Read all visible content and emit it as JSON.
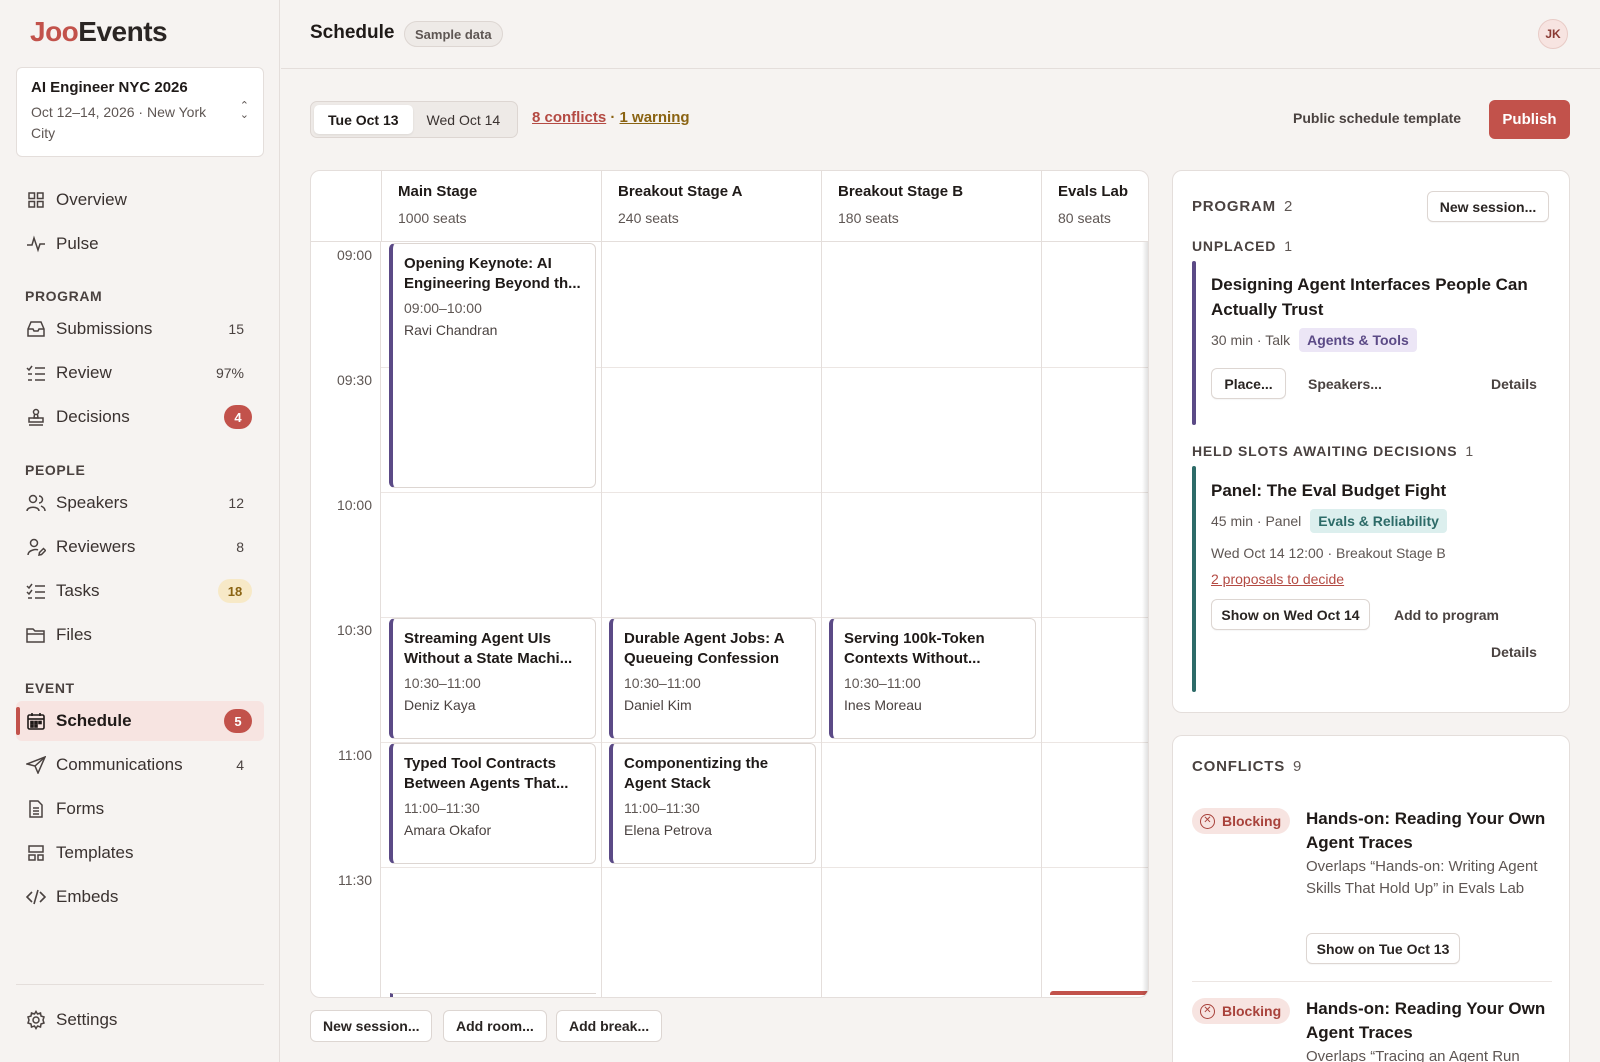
{
  "brand": {
    "logo_part1": "Joo",
    "logo_part2": "Events"
  },
  "event": {
    "name": "AI Engineer NYC 2026",
    "meta": "Oct 12–14, 2026 · New York City"
  },
  "nav": {
    "overview": "Overview",
    "pulse": "Pulse",
    "program_head": "PROGRAM",
    "submissions": {
      "label": "Submissions",
      "count": "15"
    },
    "review": {
      "label": "Review",
      "count": "97%"
    },
    "decisions": {
      "label": "Decisions",
      "count": "4"
    },
    "people_head": "PEOPLE",
    "speakers": {
      "label": "Speakers",
      "count": "12"
    },
    "reviewers": {
      "label": "Reviewers",
      "count": "8"
    },
    "tasks": {
      "label": "Tasks",
      "count": "18"
    },
    "files": {
      "label": "Files"
    },
    "event_head": "EVENT",
    "schedule": {
      "label": "Schedule",
      "count": "5"
    },
    "communications": {
      "label": "Communications",
      "count": "4"
    },
    "forms": {
      "label": "Forms"
    },
    "templates": {
      "label": "Templates"
    },
    "embeds": {
      "label": "Embeds"
    },
    "settings": {
      "label": "Settings"
    }
  },
  "header": {
    "title": "Schedule",
    "badge": "Sample data",
    "avatar": "JK"
  },
  "toolbar": {
    "day_tabs": [
      "Tue Oct 13",
      "Wed Oct 14"
    ],
    "conflicts": "8 conflicts",
    "separator": "·",
    "warnings": "1 warning",
    "public_template": "Public schedule template",
    "publish": "Publish"
  },
  "rooms": [
    {
      "name": "Main Stage",
      "seats": "1000 seats"
    },
    {
      "name": "Breakout Stage A",
      "seats": "240 seats"
    },
    {
      "name": "Breakout Stage B",
      "seats": "180 seats"
    },
    {
      "name": "Evals Lab",
      "seats": "80 seats"
    }
  ],
  "times": [
    "09:00",
    "09:30",
    "10:00",
    "10:30",
    "11:00",
    "11:30"
  ],
  "sessions": [
    {
      "title": "Opening Keynote: AI Engineering Beyond th...",
      "time": "09:00–10:00",
      "speaker": "Ravi Chandran"
    },
    {
      "title": "Streaming Agent UIs Without a State Machi...",
      "time": "10:30–11:00",
      "speaker": "Deniz Kaya"
    },
    {
      "title": "Durable Agent Jobs: A Queueing Confession",
      "time": "10:30–11:00",
      "speaker": "Daniel Kim"
    },
    {
      "title": "Serving 100k-Token Contexts Without...",
      "time": "10:30–11:00",
      "speaker": "Ines Moreau"
    },
    {
      "title": "Typed Tool Contracts Between Agents That...",
      "time": "11:00–11:30",
      "speaker": "Amara Okafor"
    },
    {
      "title": "Componentizing the Agent Stack",
      "time": "11:00–11:30",
      "speaker": "Elena Petrova"
    }
  ],
  "grid_actions": {
    "new_session": "New session...",
    "add_room": "Add room...",
    "add_break": "Add break..."
  },
  "program_panel": {
    "heading": "PROGRAM",
    "count": "2",
    "new_session": "New session...",
    "unplaced_head": "UNPLACED",
    "unplaced_count": "1",
    "unplaced": {
      "title": "Designing Agent Interfaces People Can Actually Trust",
      "meta": "30 min · Talk",
      "tag": "Agents & Tools",
      "place": "Place...",
      "speakers": "Speakers...",
      "details": "Details"
    },
    "held_head": "HELD SLOTS AWAITING DECISIONS",
    "held_count": "1",
    "held": {
      "title": "Panel: The Eval Budget Fight",
      "meta": "45 min · Panel",
      "tag": "Evals & Reliability",
      "slot": "Wed Oct 14 12:00 · Breakout Stage B",
      "proposals": "2 proposals to decide",
      "show": "Show on Wed Oct 14",
      "add": "Add to program",
      "details": "Details"
    }
  },
  "conflicts_panel": {
    "heading": "CONFLICTS",
    "count": "9",
    "items": [
      {
        "badge": "Blocking",
        "title": "Hands-on: Reading Your Own Agent Traces",
        "desc": "Overlaps “Hands-on: Writing Agent Skills That Hold Up” in Evals Lab",
        "action": "Show on Tue Oct 13"
      },
      {
        "badge": "Blocking",
        "title": "Hands-on: Reading Your Own Agent Traces",
        "desc": "Overlaps “Tracing an Agent Run"
      }
    ]
  },
  "colors": {
    "accent": "#c2524b",
    "track_purple": "#5b4a86",
    "track_teal": "#2d6b68",
    "warning": "#8a6312"
  }
}
